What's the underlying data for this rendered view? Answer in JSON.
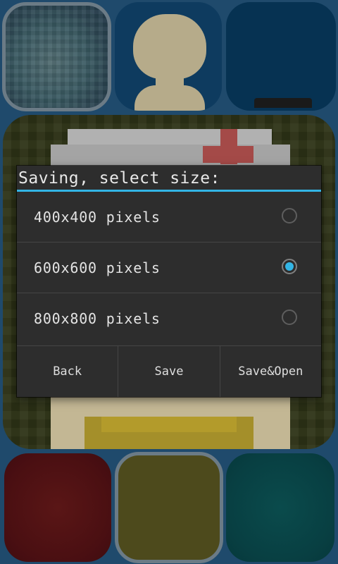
{
  "dialog": {
    "title": "Saving, select size:",
    "options": [
      {
        "label": "400x400 pixels",
        "checked": false
      },
      {
        "label": "600x600 pixels",
        "checked": true
      },
      {
        "label": "800x800 pixels",
        "checked": false
      }
    ],
    "buttons": {
      "back": "Back",
      "save": "Save",
      "save_open": "Save&Open"
    },
    "accent_color": "#33b5e5"
  },
  "palette": {
    "top_row": [
      "face-thumbnail",
      "avatar-silhouette",
      "blank-navy"
    ],
    "bottom_row": [
      "dark-red",
      "olive",
      "dark-teal"
    ],
    "selected_top": "face-thumbnail",
    "selected_bottom": "olive"
  },
  "colors": {
    "background": "#1f4a6c",
    "dialog_bg": "#2d2d2d",
    "accent": "#33b5e5"
  }
}
